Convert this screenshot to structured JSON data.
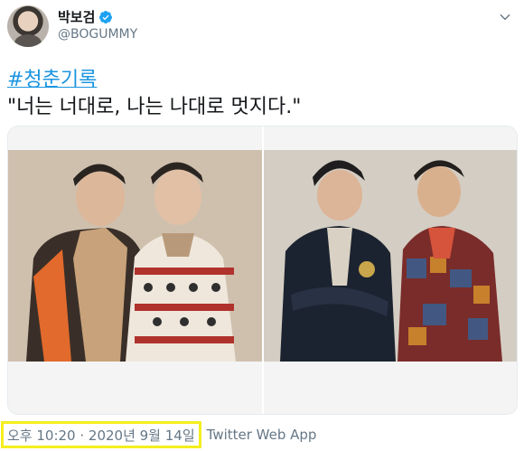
{
  "user": {
    "display_name": "박보검",
    "handle": "@BOGUMMY",
    "verified": true,
    "avatar_icon": "profile-avatar"
  },
  "tweet": {
    "hashtag": "#청춘기록",
    "text": "\"너는 너대로, 나는 나대로 멋지다.\""
  },
  "media": {
    "photos": [
      {
        "label": "photo-1"
      },
      {
        "label": "photo-2"
      }
    ]
  },
  "footer": {
    "timestamp": "오후 10:20 · 2020년 9월 14일",
    "source": "Twitter Web App",
    "highlight_color": "#f5ee1f"
  },
  "colors": {
    "link": "#1b95e0",
    "secondary": "#657786",
    "verified": "#1da1f2"
  }
}
